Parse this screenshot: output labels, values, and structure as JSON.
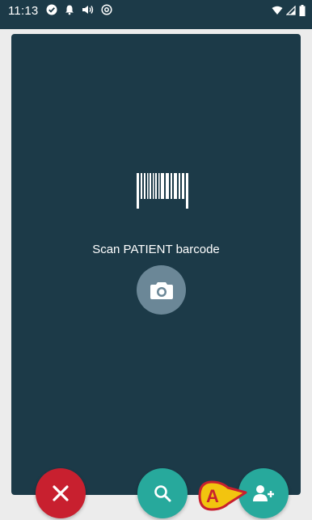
{
  "status_bar": {
    "time": "11:13",
    "icons_left": [
      "check-circle-icon",
      "bell-icon",
      "sound-icon",
      "at-icon"
    ],
    "icons_right": [
      "wifi-icon",
      "signal-icon",
      "battery-icon"
    ]
  },
  "scanner": {
    "prompt": "Scan PATIENT barcode",
    "barcode_icon": "barcode-icon",
    "camera_icon": "camera-icon"
  },
  "actions": {
    "close_icon": "close-icon",
    "search_icon": "search-icon",
    "add_patient_icon": "add-user-icon"
  },
  "callout": {
    "label": "A"
  },
  "colors": {
    "panel": "#1c3a48",
    "close": "#c8202f",
    "teal": "#27a99c",
    "camera": "#6b8797",
    "callout": "#f2c40f",
    "callout_border": "#c8202f"
  }
}
